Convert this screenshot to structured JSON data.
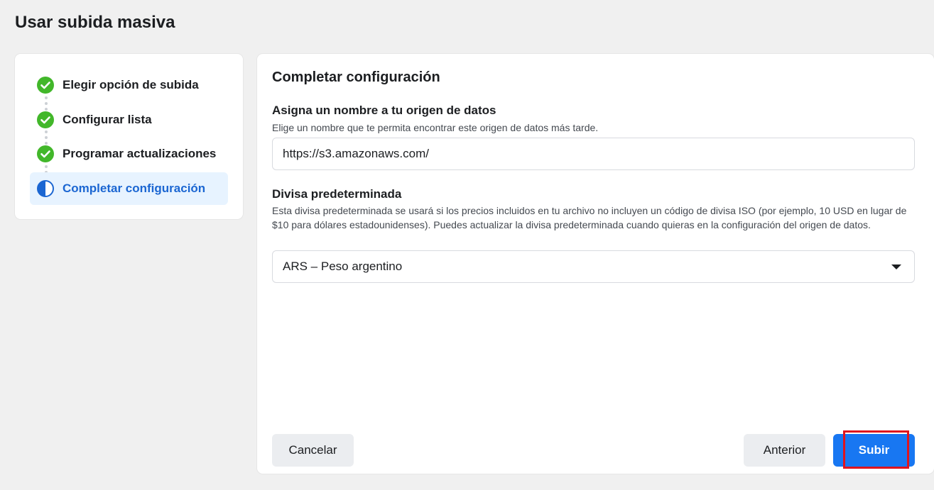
{
  "page": {
    "title": "Usar subida masiva"
  },
  "steps": [
    {
      "label": "Elegir opción de subida",
      "status": "done",
      "icon": "check-circle-icon"
    },
    {
      "label": "Configurar lista",
      "status": "done",
      "icon": "check-circle-icon"
    },
    {
      "label": "Programar actualizaciones",
      "status": "done",
      "icon": "check-circle-icon"
    },
    {
      "label": "Completar configuración",
      "status": "active",
      "icon": "half-circle-icon"
    }
  ],
  "main": {
    "title": "Completar configuración",
    "name_field": {
      "label": "Asigna un nombre a tu origen de datos",
      "help": "Elige un nombre que te permita encontrar este origen de datos más tarde.",
      "value": "https://s3.amazonaws.com/"
    },
    "currency_field": {
      "label": "Divisa predeterminada",
      "help": "Esta divisa predeterminada se usará si los precios incluidos en tu archivo no incluyen un código de divisa ISO (por ejemplo, 10 USD en lugar de $10 para dólares estadounidenses). Puedes actualizar la divisa predeterminada cuando quieras en la configuración del origen de datos.",
      "selected": "ARS – Peso argentino"
    }
  },
  "footer": {
    "cancel_label": "Cancelar",
    "back_label": "Anterior",
    "submit_label": "Subir"
  },
  "colors": {
    "done_green": "#42b72a",
    "active_blue": "#1b66d2",
    "primary": "#1877f2",
    "highlight_red": "#e0141e"
  }
}
